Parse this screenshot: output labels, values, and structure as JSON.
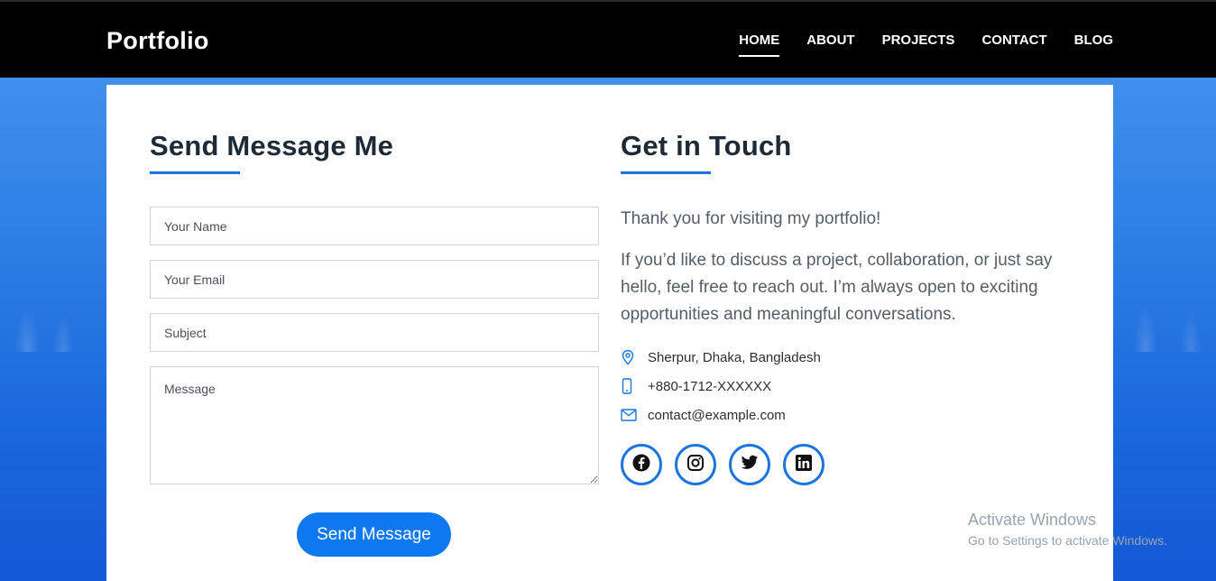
{
  "header": {
    "brand": "Portfolio",
    "nav": [
      {
        "label": "HOME",
        "active": true
      },
      {
        "label": "ABOUT"
      },
      {
        "label": "PROJECTS"
      },
      {
        "label": "CONTACT"
      },
      {
        "label": "BLOG"
      }
    ]
  },
  "form": {
    "heading": "Send Message Me",
    "name_placeholder": "Your Name",
    "email_placeholder": "Your Email",
    "subject_placeholder": "Subject",
    "message_placeholder": "Message",
    "submit_label": "Send Message"
  },
  "contact": {
    "heading": "Get in Touch",
    "intro1": "Thank you for visiting my portfolio!",
    "intro2": "If you’d like to discuss a project, collaboration, or just say hello, feel free to reach out. I’m always open to exciting opportunities and meaningful conversations.",
    "address": "Sherpur, Dhaka, Bangladesh",
    "phone": "+880-1712-XXXXXX",
    "email": "contact@example.com",
    "socials": [
      "facebook-icon",
      "instagram-icon",
      "twitter-icon",
      "linkedin-icon"
    ]
  },
  "watermark": {
    "title": "Activate Windows",
    "subtitle": "Go to Settings to activate Windows."
  },
  "colors": {
    "accent": "#1b75e1",
    "button": "#0d78f0",
    "topbar": "#000000"
  }
}
